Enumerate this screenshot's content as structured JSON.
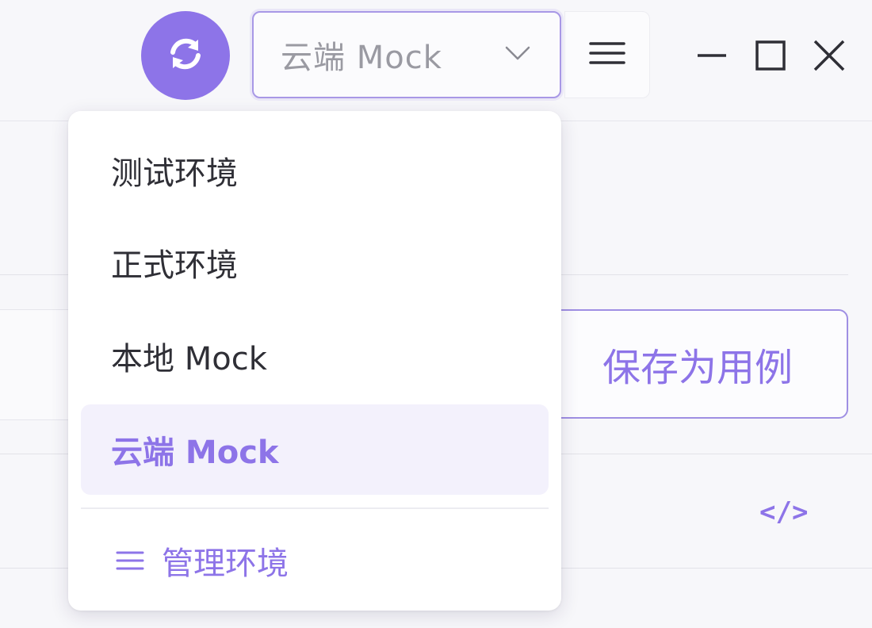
{
  "toolbar": {
    "sync_icon": "sync-icon",
    "env_select": {
      "value": "云端 Mock",
      "icon": "chevron-down-icon"
    },
    "menu_icon": "hamburger-menu-icon",
    "window_controls": [
      "minimize-icon",
      "maximize-icon",
      "close-icon"
    ]
  },
  "background": {
    "save_case_label": "保存为用例",
    "code_toggle_label": "</>"
  },
  "dropdown": {
    "items": [
      {
        "label": "测试环境",
        "selected": false
      },
      {
        "label": "正式环境",
        "selected": false
      },
      {
        "label": "本地 Mock",
        "selected": false
      },
      {
        "label": "云端 Mock",
        "selected": true
      }
    ],
    "manage": {
      "label": "管理环境",
      "icon": "list-icon"
    }
  },
  "colors": {
    "accent": "#8d74e8",
    "selected_bg": "#f3f1fc",
    "text": "#2f2f36",
    "muted": "#9a9aa2"
  }
}
